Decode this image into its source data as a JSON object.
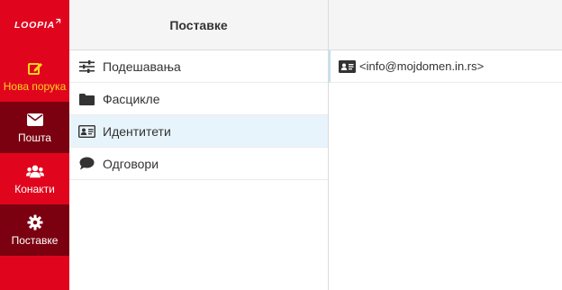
{
  "brand": {
    "logo_text": "LOOPIA",
    "accent_color": "#e0051d",
    "active_color": "#ffd21f"
  },
  "nav": [
    {
      "label": "Нова порука",
      "icon": "pencil-square-icon"
    },
    {
      "label": "Пошта",
      "icon": "envelope-icon"
    },
    {
      "label": "Конакти",
      "icon": "users-icon"
    },
    {
      "label": "Поставке",
      "icon": "gear-icon"
    }
  ],
  "settings": {
    "header": "Поставке",
    "items": [
      {
        "label": "Подешавања",
        "icon": "sliders-icon"
      },
      {
        "label": "Фасцикле",
        "icon": "folder-icon"
      },
      {
        "label": "Идентитети",
        "icon": "id-card-icon"
      },
      {
        "label": "Одговори",
        "icon": "comment-icon"
      }
    ]
  },
  "identities": {
    "items": [
      {
        "label": "<info@mojdomen.in.rs>",
        "icon": "id-card-icon"
      }
    ]
  }
}
